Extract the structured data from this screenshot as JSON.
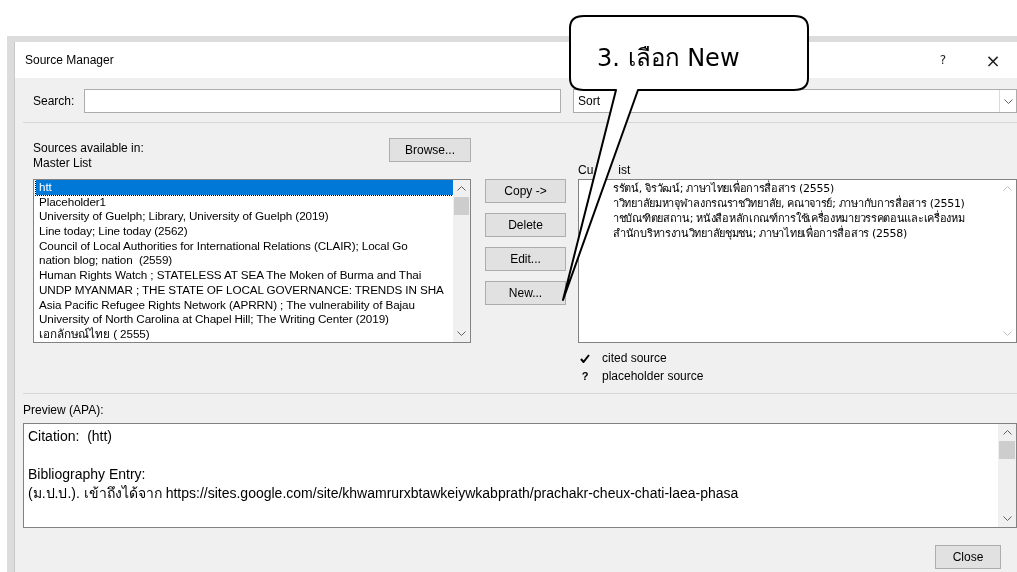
{
  "window": {
    "title": "Source Manager",
    "help": "?",
    "close": "×"
  },
  "search": {
    "label": "Search:"
  },
  "sort": {
    "value": "Sort"
  },
  "master": {
    "heading": "Sources available in:",
    "list_name": "Master List",
    "browse": "Browse...",
    "items": [
      {
        "text": "htt",
        "selected": true
      },
      {
        "text": "Placeholder1",
        "selected": false
      },
      {
        "text": "University of Guelph; Library, University of Guelph (2019)",
        "selected": false
      },
      {
        "text": "Line today; Line today (2562)",
        "selected": false
      },
      {
        "text": "Council of Local Authorities for International Relations (CLAIR); Local Go",
        "selected": false
      },
      {
        "text": "nation blog; nation  (2559)",
        "selected": false
      },
      {
        "text": "Human Rights Watch ; STATELESS AT SEA The Moken of Burma and Thai",
        "selected": false
      },
      {
        "text": "UNDP MYANMAR ; THE STATE OF LOCAL GOVERNANCE: TRENDS IN SHA",
        "selected": false
      },
      {
        "text": "Asia Pacific Refugee Rights Network (APRRN) ; The vulnerability of Bajau",
        "selected": false
      },
      {
        "text": "University of North Carolina at Chapel Hill; The Writing Center (2019)",
        "selected": false
      },
      {
        "text": "เอกลักษณ์ไทย ( 2555)",
        "selected": false
      }
    ]
  },
  "actions": [
    "Copy ->",
    "Delete",
    "Edit...",
    "New..."
  ],
  "current": {
    "label_start": "Cu",
    "label_end": "ist",
    "items": [
      {
        "text": "รรัตน์, จิรวัฒน์; ภาษาไทยเพื่อการสื่อสาร (2555)"
      },
      {
        "text": "าวิทยาลัยมหาจุฬาลงกรณราชวิทยาลัย, คณาจารย์; ภาษากับการสื่อสาร (2551)"
      },
      {
        "text": "าชบัณฑิตยสถาน; หนังสือหลักเกณฑ์การใช้เครื่องหมายวรรคตอนและเครื่องหม"
      },
      {
        "text": "สำนักบริหารงานวิทยาลัยชุมชน; ภาษาไทยเพื่อการสื่อสาร (2558)"
      }
    ]
  },
  "legend": [
    {
      "kind": "check",
      "text": "cited source"
    },
    {
      "kind": "mark",
      "mark": "?",
      "text": "placeholder source"
    }
  ],
  "preview": {
    "label": "Preview (APA):",
    "citation": "Citation:  (htt)",
    "bibliography_heading": "Bibliography Entry:",
    "bibliography": "(ม.ป.ป.). เข้าถึงได้จาก https://sites.google.com/site/khwamrurxbtawkeiywkabprath/prachakr-cheux-chati-laea-phasa"
  },
  "close_button": "Close",
  "callout": {
    "text": "3.  เลือก New"
  }
}
